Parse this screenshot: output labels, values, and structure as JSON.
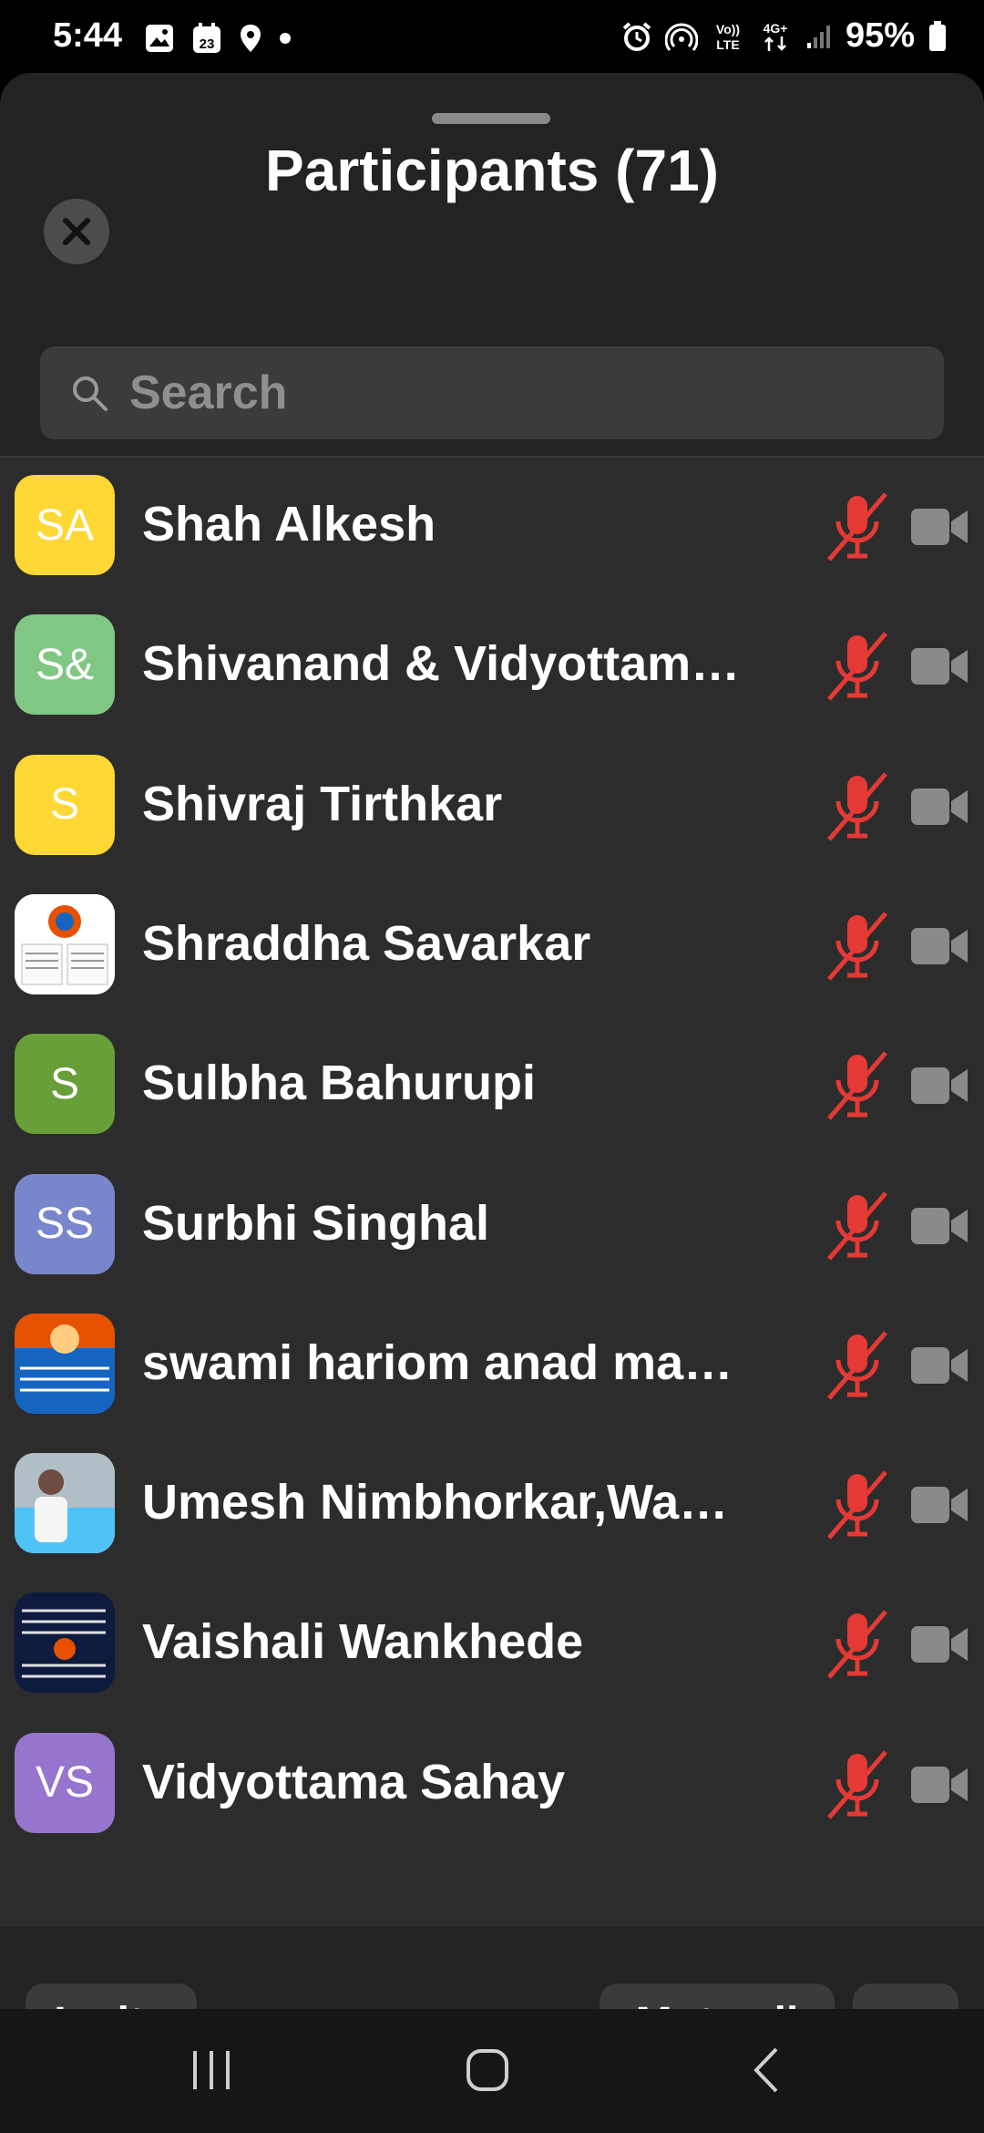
{
  "status_bar": {
    "time": "5:44",
    "calendar_day": "23",
    "battery_pct": "95%",
    "volte_label": "Vo))",
    "lte_label": "LTE",
    "network_label": "4G+",
    "left_icons": [
      "gallery-icon",
      "calendar-icon",
      "location-icon",
      "dot-icon"
    ],
    "right_icons": [
      "alarm-icon",
      "hotspot-icon",
      "volte-icon",
      "4g-icon",
      "signal-icon",
      "battery-icon"
    ]
  },
  "header": {
    "title": "Participants (71)"
  },
  "search": {
    "placeholder": "Search"
  },
  "participants": [
    {
      "name": "Shah Alkesh",
      "initials": "SA",
      "color": "#fdd835",
      "mic_muted": true
    },
    {
      "name": "Shivanand & Vidyottam…",
      "initials": "S&",
      "color": "#81c784",
      "mic_muted": true
    },
    {
      "name": "Shivraj  Tirthkar",
      "initials": "S",
      "color": "#fdd835",
      "mic_muted": true
    },
    {
      "name": "Shraddha Savarkar",
      "initials": "",
      "color": "#ffffff",
      "mic_muted": true
    },
    {
      "name": "Sulbha Bahurupi",
      "initials": "S",
      "color": "#689f38",
      "mic_muted": true
    },
    {
      "name": "Surbhi Singhal",
      "initials": "SS",
      "color": "#7986cb",
      "mic_muted": true
    },
    {
      "name": "swami hariom anad mah…",
      "initials": "",
      "color": "#1565c0",
      "mic_muted": true
    },
    {
      "name": "Umesh Nimbhorkar,War…",
      "initials": "",
      "color": "#90a4ae",
      "mic_muted": true
    },
    {
      "name": "Vaishali Wankhede",
      "initials": "",
      "color": "#0d1b3e",
      "mic_muted": true
    },
    {
      "name": "Vidyottama Sahay",
      "initials": "VS",
      "color": "#9575cd",
      "mic_muted": true
    }
  ],
  "footer": {
    "invite_label": "Invite",
    "mute_all_label": "Mute all",
    "more_label": "•••"
  },
  "colors": {
    "sheet_bg": "#232323",
    "list_bg": "#2c2c2c",
    "mic_muted": "#e53935",
    "camera_off": "#8a8a8a"
  }
}
